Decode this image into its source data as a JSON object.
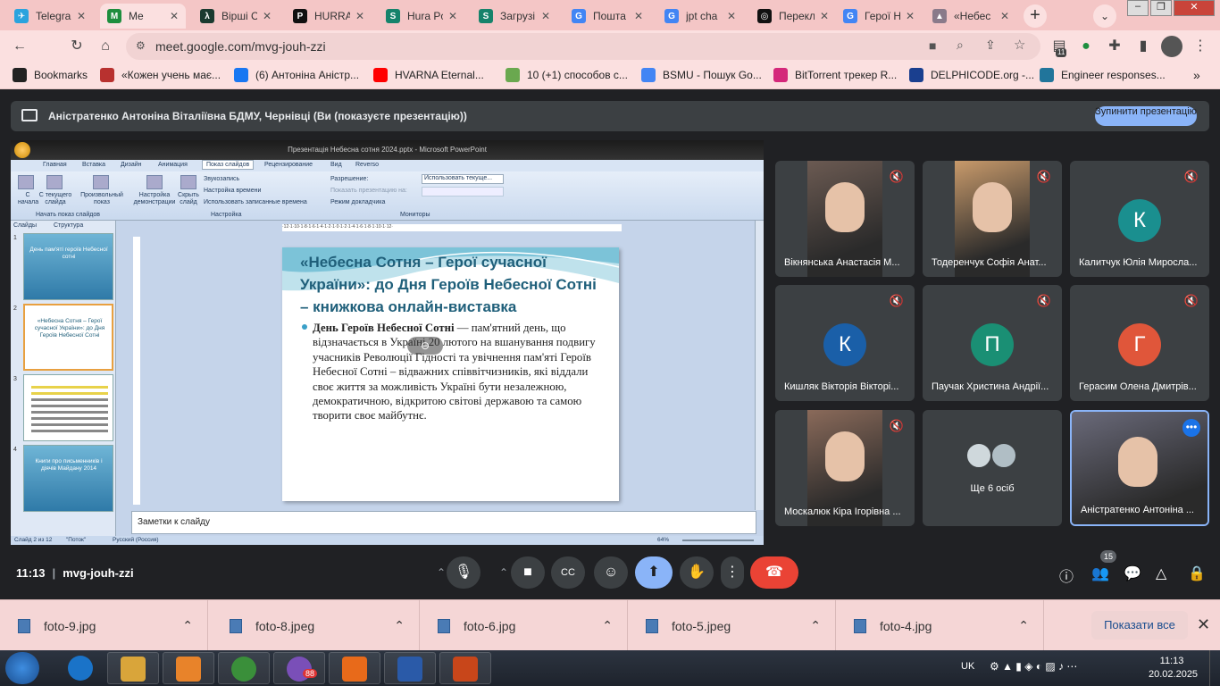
{
  "browser": {
    "tabs": [
      {
        "title": "Telegra",
        "color": "#2aa3de",
        "glyph": "✈"
      },
      {
        "title": "Me",
        "color": "#1e8e3e",
        "glyph": "M"
      },
      {
        "title": "Вірші С",
        "color": "#1b3a2f",
        "glyph": "λ"
      },
      {
        "title": "HURRA",
        "color": "#111111",
        "glyph": "P"
      },
      {
        "title": "Hura Pc",
        "color": "#16836b",
        "glyph": "S"
      },
      {
        "title": "Загрузі",
        "color": "#16836b",
        "glyph": "S"
      },
      {
        "title": "Пошта",
        "color": "#4285f4",
        "glyph": "G"
      },
      {
        "title": "jpt cha",
        "color": "#4285f4",
        "glyph": "G"
      },
      {
        "title": "Перекл",
        "color": "#111111",
        "glyph": "◎"
      },
      {
        "title": "Герої Н",
        "color": "#4285f4",
        "glyph": "G"
      },
      {
        "title": "«Небес",
        "color": "#8a7a8a",
        "glyph": "▲"
      }
    ],
    "new_tab": "+",
    "url": "meet.google.com/mvg-jouh-zzi",
    "ext_badge": "11",
    "bookmarks": [
      {
        "label": "Bookmarks",
        "color": "#222222"
      },
      {
        "label": "«Кожен учень має...",
        "color": "#b8312f"
      },
      {
        "label": "(6) Антоніна Аністр...",
        "color": "#1877f2"
      },
      {
        "label": "HVARNA Eternal...",
        "color": "#ff0000"
      },
      {
        "label": "10 (+1) способов с...",
        "color": "#6aa84f"
      },
      {
        "label": "BSMU - Пошук Go...",
        "color": "#4285f4"
      },
      {
        "label": "BitTorrent трекер R...",
        "color": "#d4287a"
      },
      {
        "label": "DELPHICODE.org -...",
        "color": "#1a3f8f"
      },
      {
        "label": "Engineer responses...",
        "color": "#21759b"
      }
    ]
  },
  "meet": {
    "presenting_text": "Аністратенко Антоніна Віталіївна БДМУ, Чернівці (Ви (показуєте презентацію))",
    "stop_button": "Зупинити презентацію",
    "meeting_time": "11:13",
    "meeting_code": "mvg-jouh-zzi",
    "people_count": "15",
    "participants": [
      {
        "name": "Вікнянська Анастасія М...",
        "type": "photo",
        "initial": "",
        "color": "#6b5a52"
      },
      {
        "name": "Тодеренчук Софія Анат...",
        "type": "photo",
        "initial": "",
        "color": "#c89a6b"
      },
      {
        "name": "Калитчук Юлія Миросла...",
        "type": "avatar",
        "initial": "К",
        "color": "#1a8f8f"
      },
      {
        "name": "Кишляк Вікторія Вікторі...",
        "type": "avatar",
        "initial": "К",
        "color": "#1a5fa8"
      },
      {
        "name": "Паучак Христина Андрії...",
        "type": "avatar",
        "initial": "П",
        "color": "#1a8f74"
      },
      {
        "name": "Герасим Олена Дмитрів...",
        "type": "avatar",
        "initial": "Г",
        "color": "#e0563a"
      },
      {
        "name": "Москалюк Кіра Ігорівна ...",
        "type": "photo",
        "initial": "",
        "color": "#8a6a5a"
      },
      {
        "name": "Ще 6 осіб",
        "type": "others",
        "initial": "",
        "color": "#3c4043"
      },
      {
        "name": "Аністратенко Антоніна ...",
        "type": "photo",
        "initial": "",
        "color": "#6a6a7a"
      }
    ]
  },
  "ppt": {
    "window_title": "Презентація Небесна сотня 2024.pptx - Microsoft PowerPoint",
    "ribbon_tabs": [
      "Главная",
      "Вставка",
      "Дизайн",
      "Анимация",
      "Показ слайдов",
      "Рецензирование",
      "Вид",
      "Reverso"
    ],
    "ribbon": {
      "btn_start": "С начала",
      "btn_current": "С текущего слайда",
      "btn_custom": "Произвольный показ",
      "group_start": "Начать показ слайдов",
      "btn_setup": "Настройка демонстрации",
      "btn_hide": "Скрыть слайд",
      "opt_record": "Звукозапись",
      "opt_timing": "Настройка времени",
      "opt_use_timing": "Использовать записанные времена",
      "group_setup": "Настройка",
      "opt_resolution": "Разрешение:",
      "resolution_value": "Использовать текуще...",
      "opt_show_on": "Показать презентацию на:",
      "opt_presenter": "Режим докладчика",
      "group_monitors": "Мониторы"
    },
    "pane_tabs": [
      "Слайды",
      "Структура"
    ],
    "thumbs": [
      {
        "num": "1",
        "text": "День пам'яті героїв Небесної сотні"
      },
      {
        "num": "2",
        "text": "«Небесна Сотня – Герої сучасної України»: до Дня Героїв Небесної Сотні"
      },
      {
        "num": "3",
        "text": ""
      },
      {
        "num": "4",
        "text": "Книги про письменників і діячів Майдану 2014"
      }
    ],
    "slide_title": "«Небесна Сотня – Герої сучасної України»: до Дня Героїв Небесної Сотні – книжкова онлайн-виставка",
    "slide_body_bold": "День Героїв Небесної Сотні",
    "slide_body": " — пам'ятний день, що відзначається в Україні 20 лютого на вшанування подвигу учасників Революції Гідності та увічнення пам'яті Героїв Небесної Сотні – відважних співвітчизників, які віддали своє життя за можливість Україні бути незалежною, демократичною, відкритою світові державою та самою творити своє майбутнє.",
    "notes_placeholder": "Заметки к слайду",
    "status_slide": "Слайд 2 из 12",
    "status_theme": "\"Поток\"",
    "status_lang": "Русский (Россия)",
    "zoom": "64%"
  },
  "downloads": {
    "items": [
      "foto-9.jpg",
      "foto-8.jpeg",
      "foto-6.jpg",
      "foto-5.jpeg",
      "foto-4.jpg"
    ],
    "show_all": "Показати все"
  },
  "taskbar": {
    "lang": "UK",
    "time": "11:13",
    "date": "20.02.2025",
    "viber_badge": "88",
    "apps": [
      {
        "name": "explorer",
        "color": "#d9a53a"
      },
      {
        "name": "media-player",
        "color": "#e8832a"
      },
      {
        "name": "chrome",
        "color": "#3a8f3a"
      },
      {
        "name": "viber",
        "color": "#7a4fb8"
      },
      {
        "name": "pdf-reader",
        "color": "#e86a1a"
      },
      {
        "name": "word",
        "color": "#2a5aa8"
      },
      {
        "name": "powerpoint",
        "color": "#c8461a"
      }
    ]
  }
}
